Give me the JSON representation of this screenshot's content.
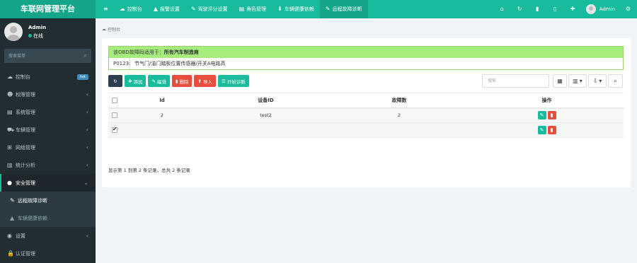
{
  "app": {
    "brand": "车联网管理平台"
  },
  "topnav": [
    {
      "icon": "menu-icon",
      "glyph": "≡",
      "label": ""
    },
    {
      "icon": "dashboard-icon",
      "glyph": "☁",
      "label": "控制台"
    },
    {
      "icon": "warning-icon",
      "glyph": "▲",
      "label": "报警设置"
    },
    {
      "icon": "wrench-icon",
      "glyph": "✎",
      "label": "驾驶评分设置"
    },
    {
      "icon": "list-icon",
      "glyph": "▤",
      "label": "角色管理"
    },
    {
      "icon": "download-icon",
      "glyph": "⬇",
      "label": "车辆健康依赖"
    },
    {
      "icon": "wrench-icon",
      "glyph": "✎",
      "label": "远程故障诊断"
    }
  ],
  "topright": {
    "buttons": [
      {
        "name": "home-icon",
        "glyph": "⌂"
      },
      {
        "name": "refresh-icon",
        "glyph": "↻"
      },
      {
        "name": "trash-icon",
        "glyph": "▮"
      },
      {
        "name": "file-icon",
        "glyph": "▯"
      },
      {
        "name": "fullscreen-icon",
        "glyph": "✚"
      }
    ],
    "user": "Admin",
    "settings_glyph": "⚙"
  },
  "sidebar": {
    "user_name": "Admin",
    "user_status": "在线",
    "search_placeholder": "搜索菜单",
    "items": [
      {
        "icon": "dashboard-icon",
        "glyph": "☁",
        "label": "控制台",
        "badge": "hot"
      },
      {
        "icon": "users-icon",
        "glyph": "☻",
        "label": "权限管理"
      },
      {
        "icon": "list-icon",
        "glyph": "▤",
        "label": "系统管理"
      },
      {
        "icon": "car-icon",
        "glyph": "⛟",
        "label": "车辆管理"
      },
      {
        "icon": "plus-square-icon",
        "glyph": "⊞",
        "label": "网络管理"
      },
      {
        "icon": "bar-chart-icon",
        "glyph": "▥",
        "label": "统计分析"
      },
      {
        "icon": "shield-icon",
        "glyph": "●",
        "label": "安全管理"
      }
    ],
    "sub_items": [
      {
        "icon": "wrench-icon",
        "glyph": "✎",
        "label": "远程故障诊断"
      },
      {
        "icon": "flask-icon",
        "glyph": "▲",
        "label": "车辆健康依赖"
      }
    ],
    "bottom_items": [
      {
        "icon": "user-circle-icon",
        "glyph": "◉",
        "label": "设置"
      },
      {
        "icon": "lock-icon",
        "glyph": "🔒",
        "label": "认证管理"
      }
    ]
  },
  "breadcrumb": {
    "glyph": "☁",
    "label": "控制台"
  },
  "notice": {
    "prefix": "该OBD故障码适用于：",
    "bold": "所有汽车制造商",
    "code": "P0123:",
    "desc": "节气门/油门踏板位置传感器/开关A电路高"
  },
  "toolbar": {
    "refresh_glyph": "↻",
    "add": "添加",
    "edit": "编辑",
    "delete": "删除",
    "import": "导入",
    "diagnose": "开始诊断"
  },
  "table_search": {
    "placeholder": "搜索"
  },
  "table": {
    "headers": [
      "Id",
      "设备ID",
      "故障数",
      "操作"
    ],
    "rows": [
      {
        "id": "2",
        "device": "test2",
        "faults": "2",
        "checked": false
      },
      {
        "id": "",
        "device": "",
        "faults": "",
        "checked": true
      }
    ]
  },
  "pagination_info": "显示第 1 到第 2 条记录，总共 2 条记录",
  "colors": {
    "primary": "#18bc9c",
    "sidebar": "#222d32",
    "danger": "#e74c3c",
    "dark": "#2c3e50",
    "notice_bg": "#a6ed7e"
  }
}
